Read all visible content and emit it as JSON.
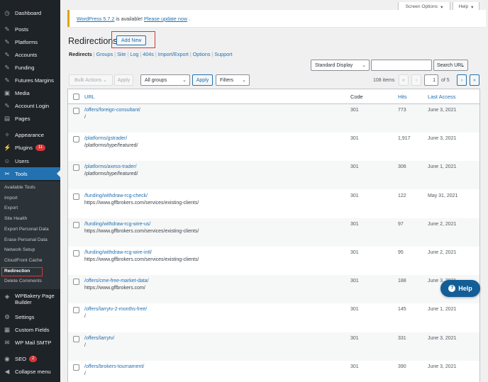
{
  "sidebar": {
    "items": [
      {
        "label": "Dashboard",
        "icon": "dashboard-icon",
        "glyph": "◷"
      },
      {
        "label": "Posts",
        "icon": "pin-icon",
        "glyph": "✎"
      },
      {
        "label": "Platforms",
        "icon": "pin-icon",
        "glyph": "✎"
      },
      {
        "label": "Accounts",
        "icon": "pin-icon",
        "glyph": "✎"
      },
      {
        "label": "Funding",
        "icon": "pin-icon",
        "glyph": "✎"
      },
      {
        "label": "Futures Margins",
        "icon": "pin-icon",
        "glyph": "✎"
      },
      {
        "label": "Media",
        "icon": "media-icon",
        "glyph": "▣"
      },
      {
        "label": "Account Login",
        "icon": "pin-icon",
        "glyph": "✎"
      },
      {
        "label": "Pages",
        "icon": "pages-icon",
        "glyph": "▤"
      },
      {
        "label": "Appearance",
        "icon": "appearance-icon",
        "glyph": "✧"
      },
      {
        "label": "Plugins",
        "icon": "plugins-icon",
        "glyph": "⚡",
        "badge": "11"
      },
      {
        "label": "Users",
        "icon": "users-icon",
        "glyph": "☺"
      },
      {
        "label": "Tools",
        "icon": "tools-icon",
        "glyph": "✂",
        "active": true
      }
    ],
    "submenu": [
      "Available Tools",
      "Import",
      "Export",
      "Site Health",
      "Export Personal Data",
      "Erase Personal Data",
      "Network Setup",
      "CloudFront Cache",
      "Redirection",
      "Delete Comments"
    ],
    "current_submenu": "Redirection",
    "bottom_items": [
      {
        "label": "WPBakery Page",
        "label2": "Builder",
        "icon": "wpbakery-icon",
        "glyph": "◈"
      },
      {
        "label": "Settings",
        "icon": "settings-icon",
        "glyph": "⚙"
      },
      {
        "label": "Custom Fields",
        "icon": "custom-fields-icon",
        "glyph": "▦"
      },
      {
        "label": "WP Mail SMTP",
        "icon": "mail-icon",
        "glyph": "✉"
      },
      {
        "label": "SEO",
        "icon": "seo-icon",
        "glyph": "◉",
        "badge": "2"
      },
      {
        "label": "Collapse menu",
        "icon": "collapse-icon",
        "glyph": "◀"
      }
    ]
  },
  "header": {
    "screen_options": "Screen Options",
    "help": "Help",
    "notice_prefix": "WordPress 5.7.2",
    "notice_middle": "is available!",
    "notice_link": "Please update now",
    "notice_suffix": "."
  },
  "page": {
    "title": "Redirections",
    "add_new": "Add New",
    "subnav": [
      "Redirects",
      "Groups",
      "Site",
      "Log",
      "404s",
      "Import/Export",
      "Options",
      "Support"
    ]
  },
  "controls": {
    "display": "Standard Display",
    "search_value": "",
    "search_button": "Search URL",
    "bulk_actions": "Bulk Actions",
    "apply": "Apply",
    "groups": "All groups",
    "apply2": "Apply",
    "filters": "Filters",
    "items_count": "108 items",
    "first": "«",
    "prev": "‹",
    "page": "1",
    "of": "of 5",
    "next": "›",
    "last": "»"
  },
  "table": {
    "columns": {
      "url": "URL",
      "code": "Code",
      "hits": "Hits",
      "last_access": "Last Access"
    },
    "rows": [
      {
        "url": "/offers/foreign-consultant/",
        "target": "/",
        "code": "301",
        "hits": "773",
        "last": "June 3, 2021"
      },
      {
        "url": "/platforms/gstrader/",
        "target": "/platforms/type/featured/",
        "code": "301",
        "hits": "1,917",
        "last": "June 3, 2021"
      },
      {
        "url": "/platforms/axess-trader/",
        "target": "/platforms/type/featured/",
        "code": "301",
        "hits": "306",
        "last": "June 1, 2021"
      },
      {
        "url": "/funding/withdraw-rcg-check/",
        "target": "https://www.gffbrokers.com/services/existing-clients/",
        "code": "301",
        "hits": "122",
        "last": "May 31, 2021"
      },
      {
        "url": "/funding/withdraw-rcg-wire-us/",
        "target": "https://www.gffbrokers.com/services/existing-clients/",
        "code": "301",
        "hits": "97",
        "last": "June 2, 2021"
      },
      {
        "url": "/funding/withdraw-rcg-wire-intl/",
        "target": "https://www.gffbrokers.com/services/existing-clients/",
        "code": "301",
        "hits": "95",
        "last": "June 2, 2021"
      },
      {
        "url": "/offers/cme-free-market-data/",
        "target": "https://www.gffbrokers.com/",
        "code": "301",
        "hits": "188",
        "last": "June 3, 2021"
      },
      {
        "url": "/offers/larrytv-2-months-free/",
        "target": "/",
        "code": "301",
        "hits": "145",
        "last": "June 1, 2021"
      },
      {
        "url": "/offers/larrytv/",
        "target": "/",
        "code": "301",
        "hits": "331",
        "last": "June 3, 2021"
      },
      {
        "url": "/offers/brokers-tournament/",
        "target": "/",
        "code": "301",
        "hits": "390",
        "last": "June 3, 2021"
      }
    ]
  },
  "help_widget": {
    "label": "Help",
    "q": "?"
  }
}
